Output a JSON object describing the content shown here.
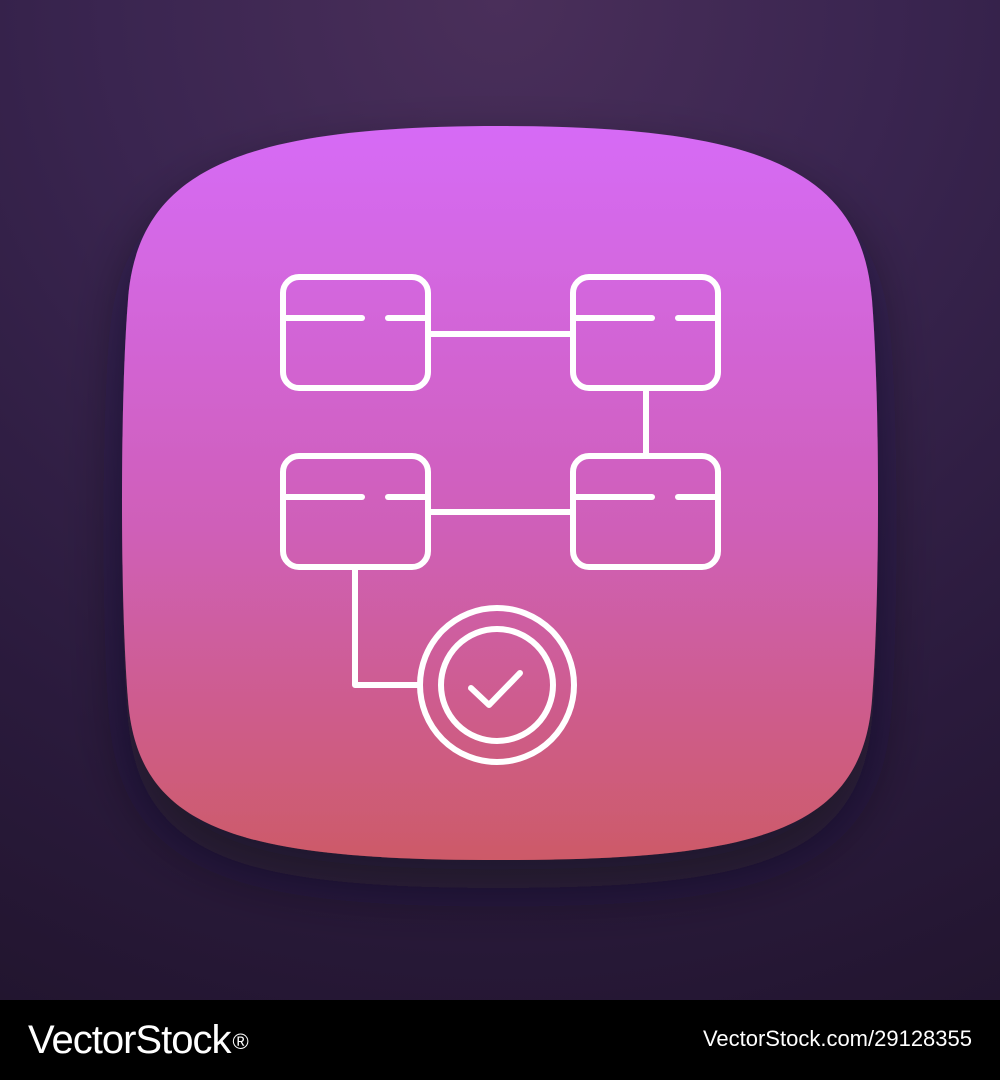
{
  "colors": {
    "background_top": "#4a2f5a",
    "background_bottom": "#22152f",
    "squircle_top": "#d46af5",
    "squircle_bottom": "#cd566b",
    "icon_stroke": "#ffffff",
    "footer_bg": "#000000"
  },
  "icon": {
    "name": "workflow-approval-icon",
    "nodes": [
      "database-node",
      "database-node",
      "database-node",
      "database-node"
    ],
    "result": "check-circle-icon"
  },
  "footer": {
    "brand": "VectorStock",
    "brand_mark": "®",
    "image_id": "VectorStock.com/29128355"
  }
}
